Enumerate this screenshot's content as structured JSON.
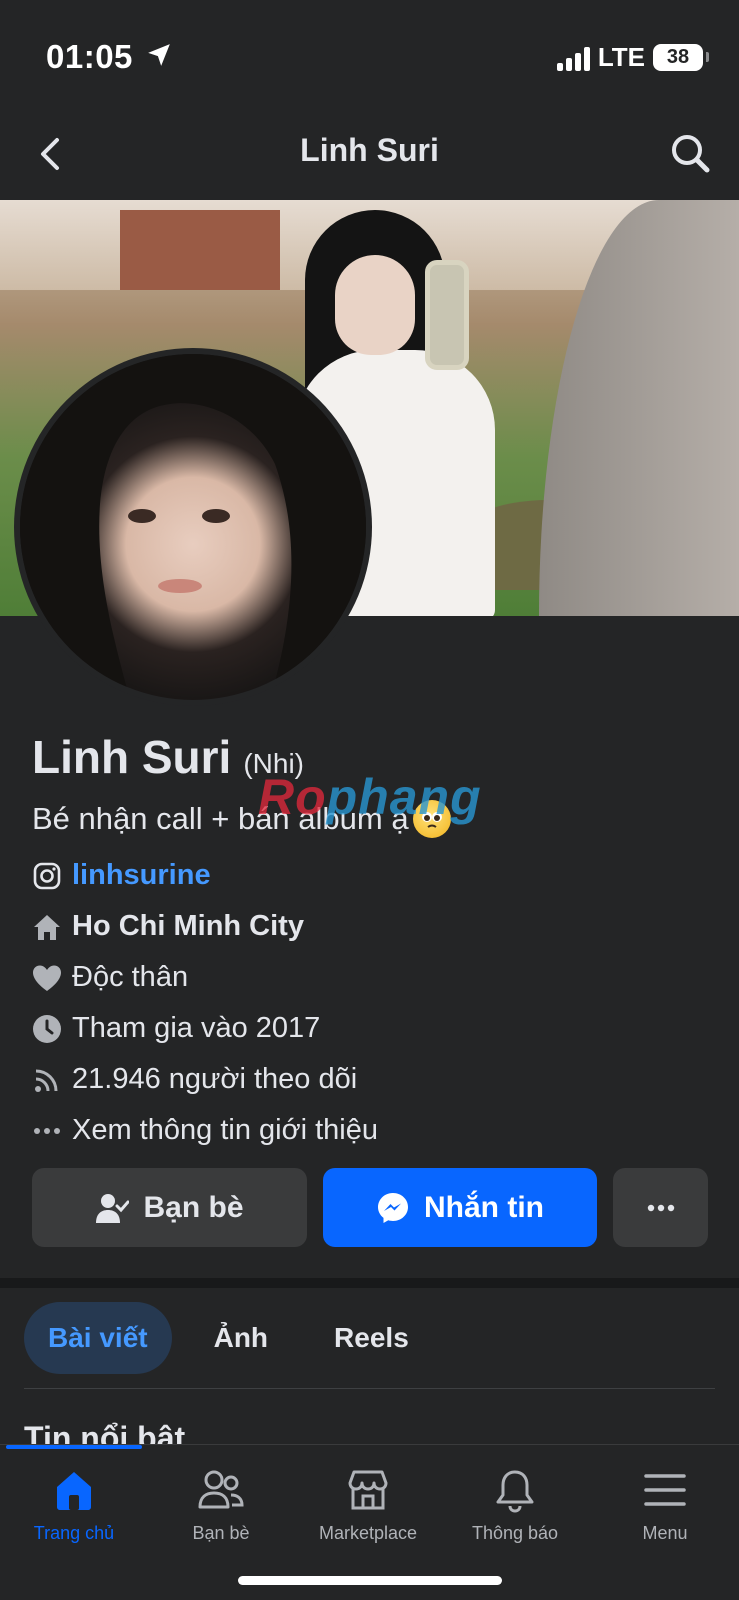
{
  "status_bar": {
    "time": "01:05",
    "network": "LTE",
    "battery": "38"
  },
  "header": {
    "title": "Linh Suri"
  },
  "profile": {
    "name": "Linh Suri",
    "alternate_name": "(Nhi)",
    "bio": "Bé nhận call + bán album ạ",
    "watermark": {
      "part1": "Ro",
      "part2": "phang"
    }
  },
  "details": [
    {
      "icon": "instagram-icon",
      "text": "linhsurine"
    },
    {
      "icon": "home-icon",
      "text": "Ho Chi Minh City"
    },
    {
      "icon": "heart-icon",
      "text": "Độc thân"
    },
    {
      "icon": "clock-icon",
      "text": "Tham gia vào 2017"
    },
    {
      "icon": "rss-icon",
      "text": "21.946 người theo dõi"
    },
    {
      "icon": "more-dots-icon",
      "text": "Xem thông tin giới thiệu"
    }
  ],
  "actions": {
    "friends": "Bạn bè",
    "message": "Nhắn tin"
  },
  "tabs": [
    {
      "label": "Bài viết",
      "active": true
    },
    {
      "label": "Ảnh",
      "active": false
    },
    {
      "label": "Reels",
      "active": false
    }
  ],
  "section_title": "Tin nổi bật",
  "bottom_nav": [
    {
      "label": "Trang chủ",
      "icon": "home-icon",
      "active": true
    },
    {
      "label": "Bạn bè",
      "icon": "friends-icon",
      "active": false
    },
    {
      "label": "Marketplace",
      "icon": "marketplace-icon",
      "active": false
    },
    {
      "label": "Thông báo",
      "icon": "bell-icon",
      "active": false
    },
    {
      "label": "Menu",
      "icon": "menu-icon",
      "active": false
    }
  ],
  "colors": {
    "accent": "#0866ff",
    "link": "#4599ff",
    "background": "#242526"
  }
}
